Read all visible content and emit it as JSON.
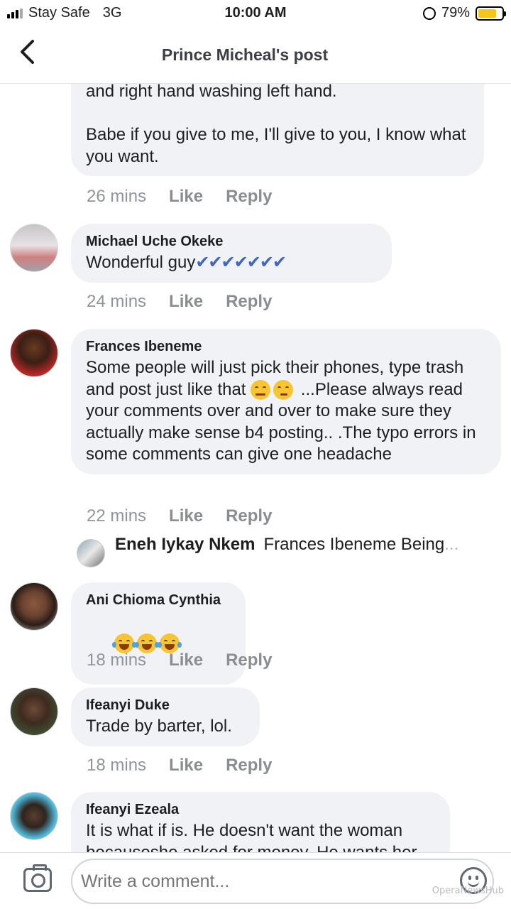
{
  "status_bar": {
    "carrier": "Stay Safe",
    "network": "3G",
    "time": "10:00 AM",
    "battery": "79%",
    "battery_level": 0.79,
    "battery_color": "#f5c518"
  },
  "header": {
    "back_icon": "chevron-left-icon",
    "title": "Prince Micheal's post"
  },
  "comments": [
    {
      "name": "",
      "text": "and right hand washing left hand.\n\nBabe if you give to me, I'll give to you, I know what you want.",
      "time": "26 mins",
      "like": "Like",
      "reply": "Reply"
    },
    {
      "name": "Michael Uche Okeke",
      "text": "Wonderful guy",
      "extra": "✔✔✔✔✔✔✔",
      "time": "24 mins",
      "like": "Like",
      "reply": "Reply"
    },
    {
      "name": "Frances Ibeneme",
      "text_a": "Some people will just pick their phones, type trash and post just like that",
      "text_b": " ...Please always read your comments over and over to make sure they actually make sense b4 posting.. .The typo errors in some comments can give one headache",
      "time": "22 mins",
      "like": "Like",
      "reply": "Reply"
    },
    {
      "name": "Ani Chioma Cynthia",
      "text": "",
      "time": "18 mins",
      "like": "Like",
      "reply": "Reply"
    },
    {
      "name": "Ifeanyi Duke",
      "text": "Trade by barter, lol.",
      "time": "18 mins",
      "like": "Like",
      "reply": "Reply"
    },
    {
      "name": "Ifeanyi Ezeala",
      "text": "It is what if is. He doesn't want the woman becauseshe asked for money. He wants her",
      "time": "",
      "like": "",
      "reply": ""
    }
  ],
  "reply_preview": {
    "name": "Eneh Iykay Nkem",
    "text": "Frances Ibeneme  Being",
    "ellipsis": "..."
  },
  "composer": {
    "placeholder": "Write a comment...",
    "camera_icon": "camera-icon",
    "emoji_icon": "smiley-icon",
    "watermark": "OperaNewsHub"
  }
}
